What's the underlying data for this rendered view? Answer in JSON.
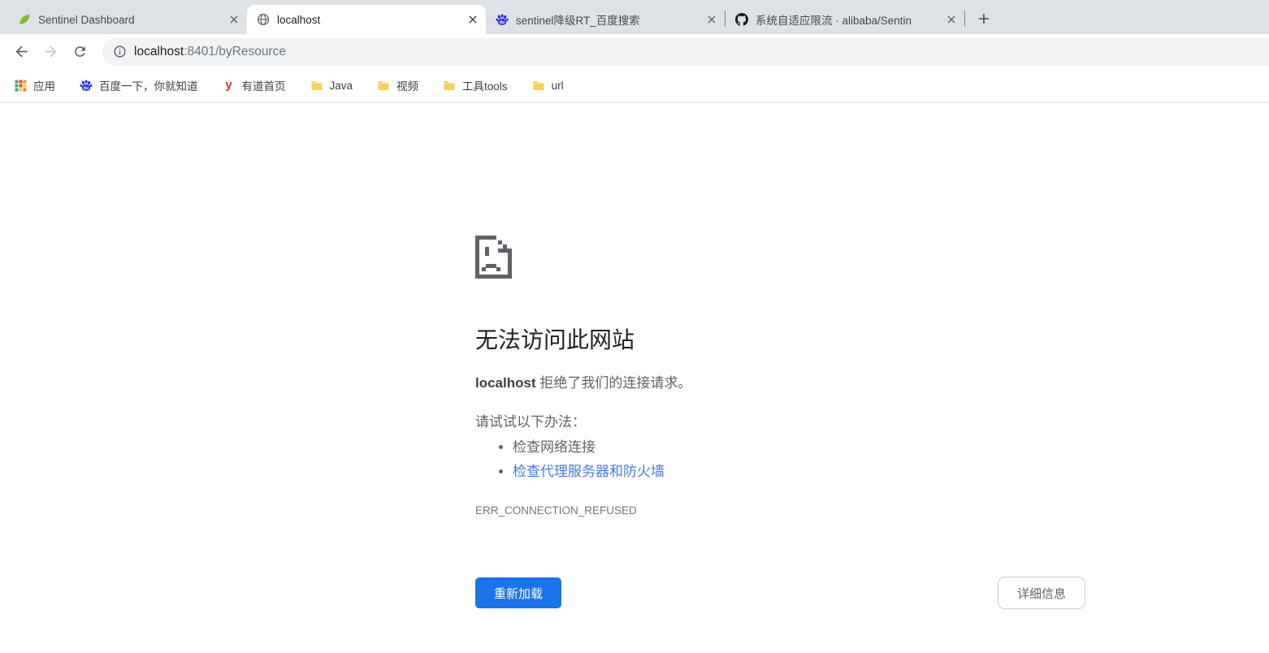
{
  "window": {
    "tabs": [
      {
        "title": "Sentinel Dashboard",
        "icon": "spring-leaf",
        "active": false
      },
      {
        "title": "localhost",
        "icon": "globe",
        "active": true
      },
      {
        "title": "sentinel降级RT_百度搜索",
        "icon": "baidu-paw",
        "active": false
      },
      {
        "title": "系统自适应限流 · alibaba/Sentin",
        "icon": "github",
        "active": false
      }
    ]
  },
  "navbar": {
    "url_host": "localhost",
    "url_rest": ":8401/byResource"
  },
  "bookmarks": [
    {
      "label": "应用",
      "icon": "apps-grid"
    },
    {
      "label": "百度一下，你就知道",
      "icon": "baidu-paw"
    },
    {
      "label": "有道首页",
      "icon": "youdao"
    },
    {
      "label": "Java",
      "icon": "folder"
    },
    {
      "label": "视频",
      "icon": "folder"
    },
    {
      "label": "工具tools",
      "icon": "folder"
    },
    {
      "label": "url",
      "icon": "folder"
    }
  ],
  "error_page": {
    "title": "无法访问此网站",
    "subtitle_host": "localhost",
    "subtitle_rest": " 拒绝了我们的连接请求。",
    "suggestions_heading": "请试试以下办法：",
    "suggestions": [
      {
        "text": "检查网络连接",
        "is_link": false
      },
      {
        "text": "检查代理服务器和防火墙",
        "is_link": true
      }
    ],
    "error_code": "ERR_CONNECTION_REFUSED",
    "reload_button": "重新加载",
    "details_button": "详细信息"
  },
  "colors": {
    "accent_blue": "#1a73e8",
    "link_blue": "#4879e8",
    "tabstrip_bg": "#dee1e6",
    "text_dark": "#202124",
    "text_gray": "#5f6368"
  }
}
